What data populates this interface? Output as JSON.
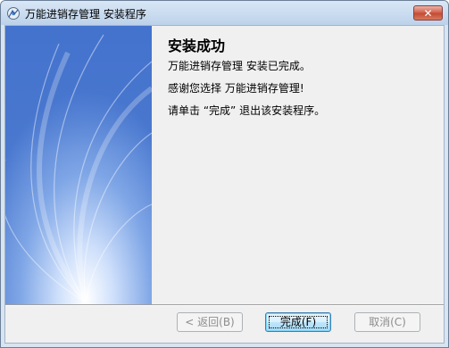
{
  "window": {
    "title": "万能进销存管理 安装程序",
    "close_label": "✕"
  },
  "content": {
    "heading": "安装成功",
    "line1": "万能进销存管理   安装已完成。",
    "line2": "感谢您选择 万能进销存管理!",
    "line3": "请单击 “完成” 退出该安装程序。"
  },
  "buttons": {
    "back": "< 返回(B)",
    "finish": "完成(F)",
    "cancel": "取消(C)"
  },
  "colors": {
    "sidebar_blue": "#4f7fd3",
    "panel_bg": "#f0f0f0"
  }
}
